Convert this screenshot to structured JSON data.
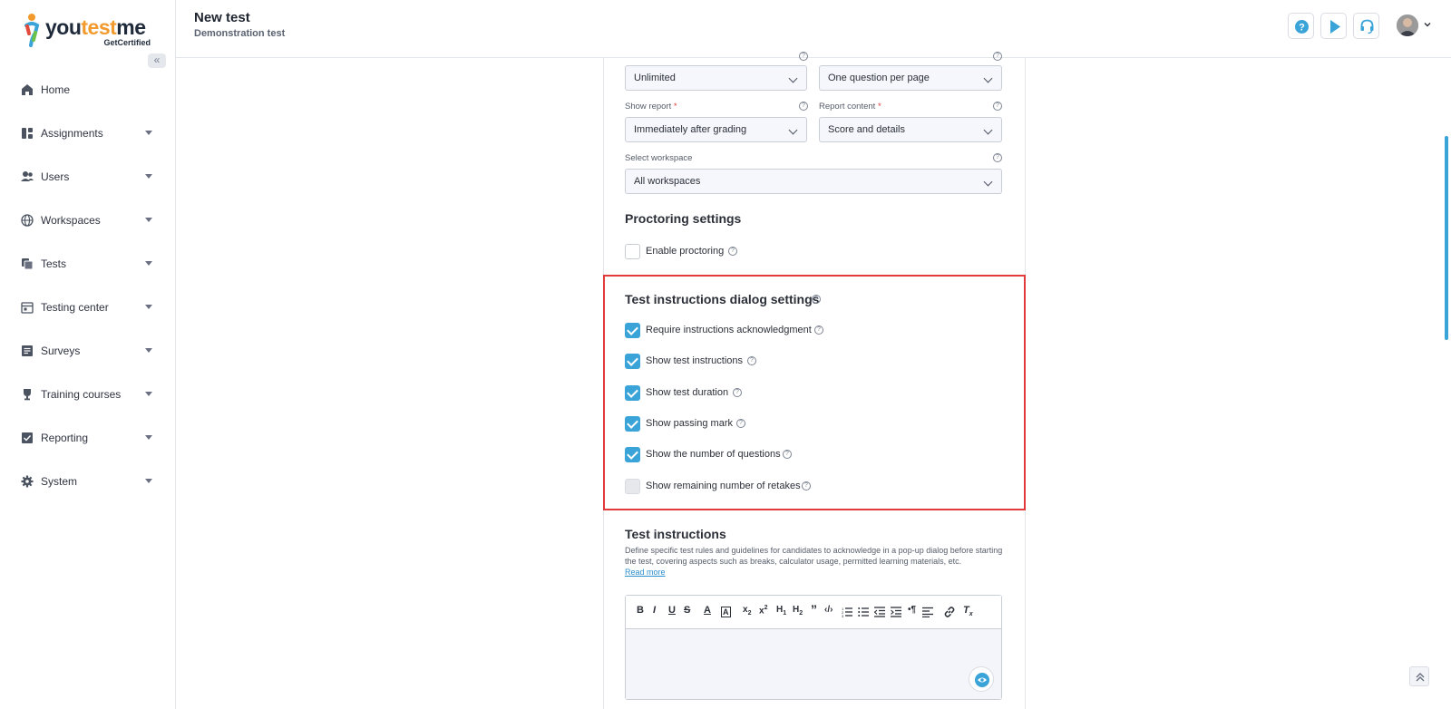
{
  "brand": {
    "name_part1": "you",
    "name_part2": "test",
    "name_part3": "me",
    "tagline": "GetCertified"
  },
  "header": {
    "title": "New test",
    "subtitle": "Demonstration test"
  },
  "sidebar": {
    "items": [
      {
        "label": "Home",
        "icon": "home-icon",
        "has_caret": false
      },
      {
        "label": "Assignments",
        "icon": "assignments-icon",
        "has_caret": true
      },
      {
        "label": "Users",
        "icon": "users-icon",
        "has_caret": true
      },
      {
        "label": "Workspaces",
        "icon": "globe-icon",
        "has_caret": true
      },
      {
        "label": "Tests",
        "icon": "tests-icon",
        "has_caret": true
      },
      {
        "label": "Testing center",
        "icon": "calendar-icon",
        "has_caret": true
      },
      {
        "label": "Surveys",
        "icon": "surveys-icon",
        "has_caret": true
      },
      {
        "label": "Training courses",
        "icon": "trophy-icon",
        "has_caret": true
      },
      {
        "label": "Reporting",
        "icon": "reporting-icon",
        "has_caret": true
      },
      {
        "label": "System",
        "icon": "gear-icon",
        "has_caret": true
      }
    ]
  },
  "form": {
    "top_left_select": "Unlimited",
    "top_right_select": "One question per page",
    "show_report": {
      "label": "Show report",
      "required": "*",
      "value": "Immediately after grading"
    },
    "report_content": {
      "label": "Report content",
      "required": "*",
      "value": "Score and details"
    },
    "workspace": {
      "label": "Select workspace",
      "value": "All workspaces"
    },
    "proctoring": {
      "title": "Proctoring settings",
      "enable_label": "Enable proctoring",
      "enabled": false
    },
    "dialog_settings": {
      "title": "Test instructions dialog settings",
      "options": [
        {
          "label": "Require instructions acknowledgment",
          "checked": true
        },
        {
          "label": "Show test instructions",
          "checked": true
        },
        {
          "label": "Show test duration",
          "checked": true
        },
        {
          "label": "Show passing mark",
          "checked": true
        },
        {
          "label": "Show the number of questions",
          "checked": true
        },
        {
          "label": "Show remaining number of retakes",
          "checked": false
        }
      ]
    },
    "instructions": {
      "title": "Test instructions",
      "description": "Define specific test rules and guidelines for candidates to acknowledge in a pop-up dialog before starting the test, covering aspects such as breaks, calculator usage, permitted learning materials, etc.",
      "read_more": "Read more"
    }
  },
  "colors": {
    "accent": "#3aa4d9",
    "highlight": "#e23b3b"
  }
}
